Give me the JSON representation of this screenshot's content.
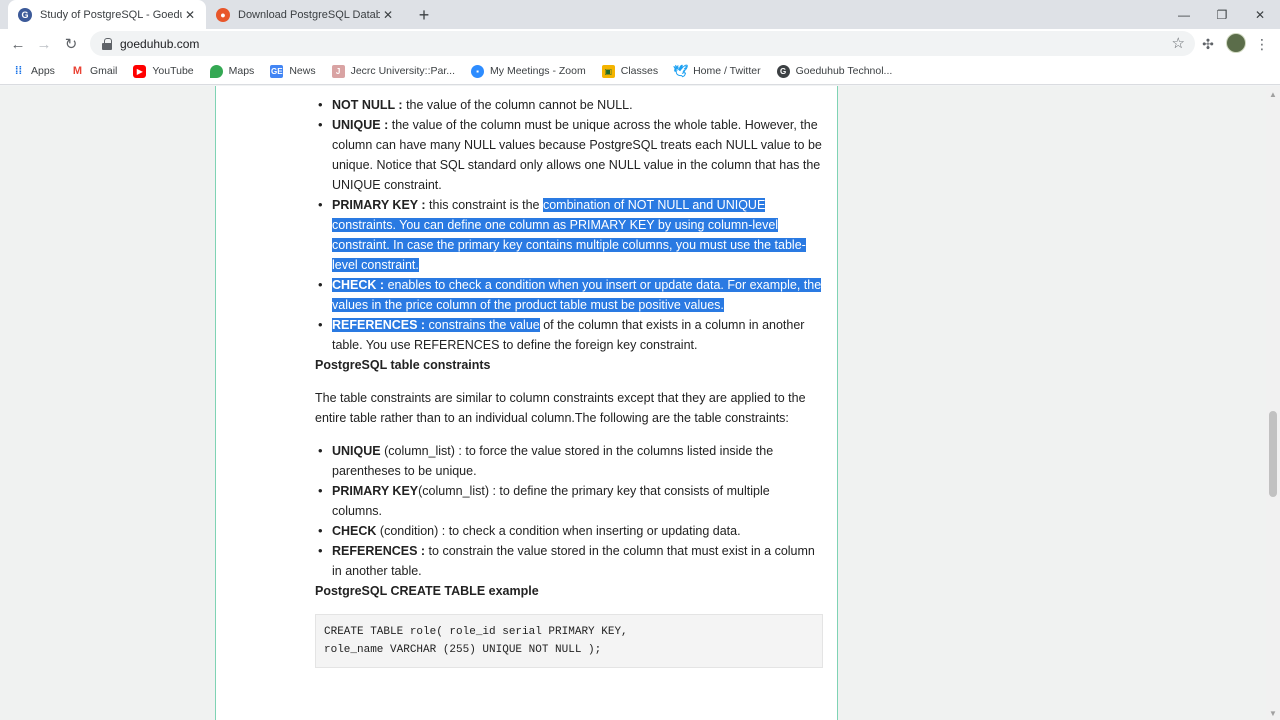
{
  "tabs": [
    {
      "title": "Study of PostgreSQL - Goeduhub",
      "icon": "goeduhub-favicon",
      "active": true
    },
    {
      "title": "Download PostgreSQL Database",
      "icon": "download-favicon",
      "active": false
    }
  ],
  "toolbar": {
    "url": "goeduhub.com"
  },
  "bookmarks": [
    {
      "label": "Apps",
      "icon": "apps-grid-icon"
    },
    {
      "label": "Gmail",
      "icon": "gmail-icon"
    },
    {
      "label": "YouTube",
      "icon": "youtube-icon"
    },
    {
      "label": "Maps",
      "icon": "maps-icon"
    },
    {
      "label": "News",
      "icon": "news-icon"
    },
    {
      "label": "Jecrc University::Par...",
      "icon": "jecrc-icon"
    },
    {
      "label": "My Meetings - Zoom",
      "icon": "zoom-icon"
    },
    {
      "label": "Classes",
      "icon": "classes-icon"
    },
    {
      "label": "Home / Twitter",
      "icon": "twitter-icon"
    },
    {
      "label": "Goeduhub Technol...",
      "icon": "goeduhub-icon"
    }
  ],
  "article": {
    "column_constraints": [
      {
        "term": "NOT NULL :",
        "desc": " the value of the column cannot be NULL."
      },
      {
        "term": "UNIQUE :",
        "desc": " the value of the column must be unique across the whole table. However, the column can have many NULL values because PostgreSQL treats each NULL value to be unique. Notice that SQL standard only allows one NULL value in the column that has the UNIQUE constraint."
      },
      {
        "term": "PRIMARY KEY :",
        "desc_plain": " this constraint is the ",
        "desc_hl": "combination of NOT NULL and UNIQUE constraints. You can define one column as PRIMARY KEY by using column-level constraint. In case the primary key contains multiple columns, you must use the table-level constraint. "
      },
      {
        "term": "CHECK :",
        "desc_hl": " enables to check a condition when you insert or update data. For example, the values in the price column of the product table must be positive values. "
      },
      {
        "term": "REFERENCES :",
        "desc_hl": " constrains the value",
        "desc_plain": " of the column that exists in a column in another table. You use REFERENCES to define the foreign key constraint."
      }
    ],
    "table_constraints_title": "PostgreSQL table constraints",
    "table_constraints_intro": "The table constraints are similar to column constraints except that they are applied to the entire table rather than to an individual column.The following are the table constraints:",
    "table_constraints": [
      {
        "term": "UNIQUE",
        "desc": " (column_list) :  to force the value stored in the columns listed inside the parentheses to be unique."
      },
      {
        "term": "PRIMARY KEY",
        "desc": "(column_list) : to define the primary key that consists of multiple columns."
      },
      {
        "term": "CHECK",
        "desc": " (condition) :  to check a condition when inserting or updating data."
      },
      {
        "term": "REFERENCES :",
        "desc": " to constrain the value stored in the column that must exist in a column in another table."
      }
    ],
    "create_table_title": "PostgreSQL CREATE TABLE example",
    "code_lines": [
      "CREATE TABLE role( role_id serial PRIMARY KEY,",
      "role_name VARCHAR (255) UNIQUE NOT NULL );"
    ]
  },
  "colors": {
    "selection": "#2a7ae2",
    "article_border": "#7fd3b4"
  }
}
